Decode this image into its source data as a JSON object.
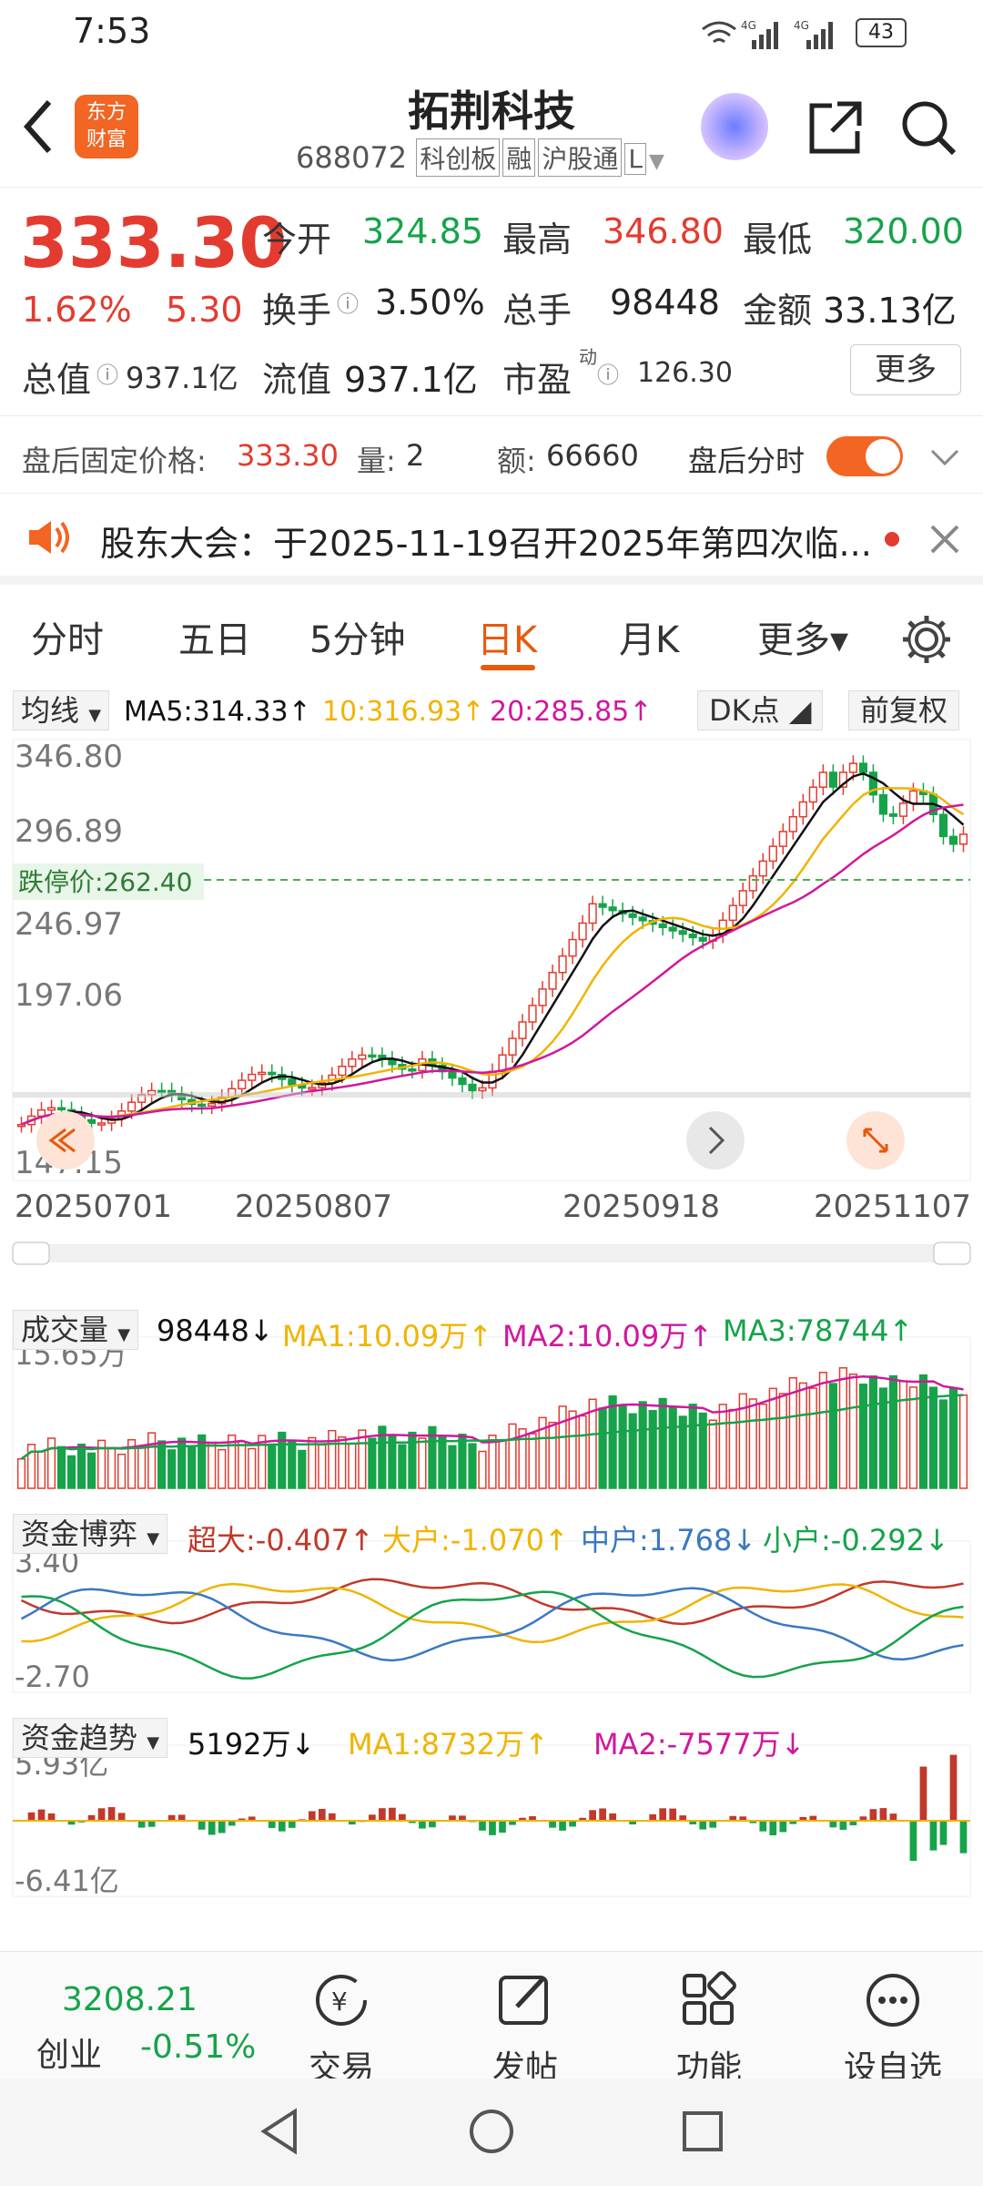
{
  "status_bar": {
    "time": "7:53",
    "battery": "43"
  },
  "header": {
    "title": "拓荆科技",
    "code": "688072",
    "tags": [
      "科创板",
      "融",
      "沪股通",
      "L"
    ]
  },
  "quote": {
    "price": "333.30",
    "change_pct": "1.62%",
    "change": "5.30",
    "open_label": "今开",
    "open": "324.85",
    "high_label": "最高",
    "high": "346.80",
    "low_label": "最低",
    "low": "320.00",
    "turnover_label": "换手",
    "turnover": "3.50%",
    "volume_label": "总手",
    "volume": "98448",
    "amount_label": "金额",
    "amount": "33.13亿",
    "mcap_label": "总值",
    "mcap": "937.1亿",
    "float_label": "流值",
    "float_cap": "937.1亿",
    "pe_label": "市盈",
    "pe_sup": "动",
    "pe": "126.30",
    "more": "更多"
  },
  "after_hours": {
    "price_label": "盘后固定价格:",
    "price": "333.30",
    "qty_label": "量:",
    "qty": "2",
    "amount_label": "额:",
    "amount": "66660",
    "toggle_label": "盘后分时"
  },
  "notice": {
    "text": "股东大会：于2025-11-19召开2025年第四次临..."
  },
  "tabs": {
    "items": [
      "分时",
      "五日",
      "5分钟",
      "日K",
      "月K",
      "更多▾"
    ],
    "active": 3
  },
  "kline": {
    "indicator": "均线",
    "ma5": "MA5:314.33↑",
    "ma10": "10:316.93↑",
    "ma20": "20:285.85↑",
    "dk": "DK点",
    "fq": "前复权",
    "y_labels": [
      "346.80",
      "296.89",
      "246.97",
      "197.06",
      "147.15"
    ],
    "limit_down": "跌停价:262.40",
    "x_labels": [
      "20250701",
      "20250807",
      "20250918",
      "20251107"
    ],
    "colors": {
      "ma5": "#111111",
      "ma10": "#f0b400",
      "ma20": "#d0189c",
      "up": "#e33b2f",
      "down": "#16a34a"
    }
  },
  "volume": {
    "indicator": "成交量",
    "value": "98448↓",
    "ma1": "MA1:10.09万↑",
    "ma2": "MA2:10.09万↑",
    "ma3": "MA3:78744↑",
    "y_label": "15.65万"
  },
  "fund_game": {
    "indicator": "资金博弈",
    "super": "超大:-0.407↑",
    "large": "大户:-1.070↑",
    "mid": "中户:1.768↓",
    "small": "小户:-0.292↓",
    "y_top": "3.40",
    "y_bottom": "-2.70"
  },
  "fund_trend": {
    "indicator": "资金趋势",
    "value": "5192万↓",
    "ma1": "MA1:8732万↑",
    "ma2": "MA2:-7577万↓",
    "y_top": "5.93亿",
    "y_bottom": "-6.41亿"
  },
  "bottom_nav": {
    "index_value": "3208.21",
    "index_name": "创业",
    "index_change": "-0.51%",
    "trade": "交易",
    "post": "发帖",
    "function": "功能",
    "watch": "设自选"
  }
}
